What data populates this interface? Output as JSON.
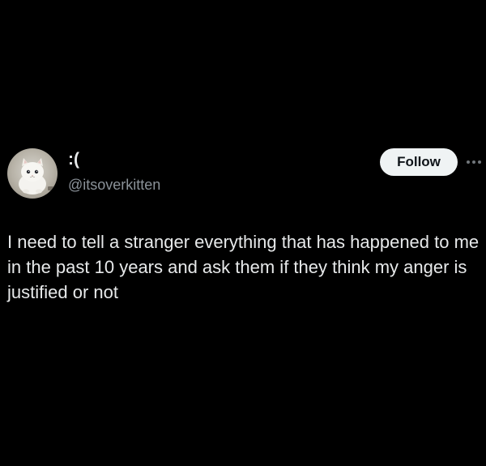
{
  "tweet": {
    "display_name": ":(",
    "handle": "@itsoverkitten",
    "follow_label": "Follow",
    "text": "I need to tell a stranger everything that has happened to me in the past 10 years and ask them if they think my anger is justified or not"
  },
  "icons": {
    "more": "more-horizontal-icon",
    "avatar": "kitten-avatar"
  },
  "colors": {
    "background": "#000000",
    "text_primary": "#e7e9ea",
    "text_secondary": "#8b9299",
    "follow_bg": "#eff3f4",
    "follow_text": "#0f1419"
  }
}
